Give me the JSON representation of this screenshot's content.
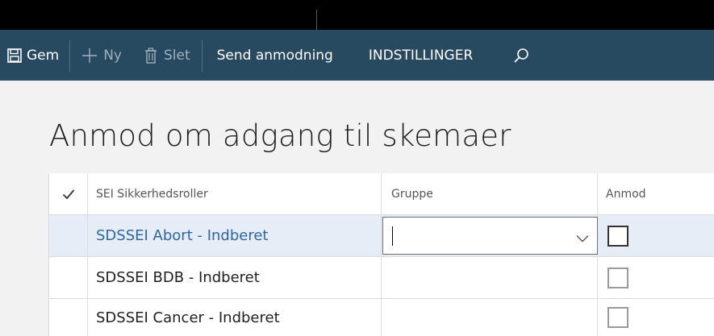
{
  "toolbar": {
    "save_label": "Gem",
    "new_label": "Ny",
    "delete_label": "Slet",
    "send_request_label": "Send anmodning",
    "settings_label": "INDSTILLINGER"
  },
  "page": {
    "title": "Anmod om adgang til skemaer"
  },
  "grid": {
    "columns": {
      "role": "SEI Sikkerhedsroller",
      "group": "Gruppe",
      "request": "Anmod"
    },
    "rows": [
      {
        "role": "SDSSEI Abort - Indberet",
        "group": "",
        "requested": false
      },
      {
        "role": "SDSSEI BDB - Indberet",
        "group": "",
        "requested": false
      },
      {
        "role": "SDSSEI Cancer - Indberet",
        "group": "",
        "requested": false
      }
    ]
  },
  "colors": {
    "top_bar": "#000000",
    "action_bar": "#284a60",
    "selected_row": "#e6edf7",
    "link_text": "#2d66a8"
  }
}
